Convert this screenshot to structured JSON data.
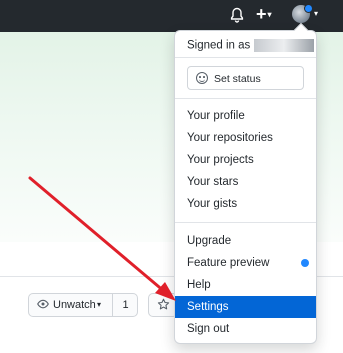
{
  "topbar": {
    "bell_icon": "bell-icon",
    "plus_icon": "plus-icon",
    "plus_text": "+",
    "caret": "▾",
    "avatar": "user-avatar"
  },
  "repo_actions": {
    "unwatch_label": "Unwatch",
    "watch_count": "1",
    "star_icon": "star-icon"
  },
  "menu": {
    "signed_in_text": "Signed in as",
    "set_status_label": "Set status",
    "profile_items": [
      "Your profile",
      "Your repositories",
      "Your projects",
      "Your stars",
      "Your gists"
    ],
    "other_items": [
      "Upgrade",
      "Feature preview",
      "Help",
      "Settings",
      "Sign out"
    ],
    "active_item": "Settings"
  },
  "colors": {
    "header_bg": "#24292e",
    "highlight": "#0366d6",
    "arrow": "#e0202a",
    "notification_dot": "#2188ff"
  }
}
